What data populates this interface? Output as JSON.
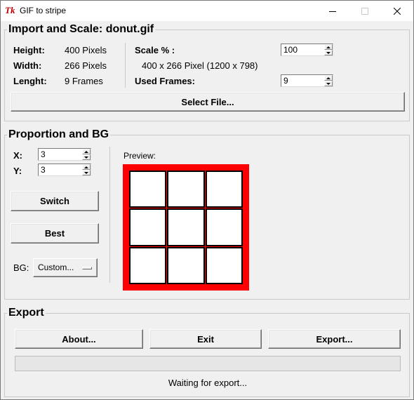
{
  "window": {
    "title": "GIF to stripe",
    "icon": "tk-feather-icon"
  },
  "import_group": {
    "title": "Import and Scale: donut.gif",
    "height_label": "Height:",
    "height_value": "400 Pixels",
    "width_label": "Width:",
    "width_value": "266 Pixels",
    "length_label": "Lenght:",
    "length_value": "9 Frames",
    "scale_label": "Scale % :",
    "scale_value": "100",
    "scaled_size": "400 x 266 Pixel (1200 x 798)",
    "used_frames_label": "Used Frames:",
    "used_frames_value": "9",
    "select_file_label": "Select File..."
  },
  "proportion_group": {
    "title": "Proportion and BG",
    "x_label": "X:",
    "x_value": "3",
    "y_label": "Y:",
    "y_value": "3",
    "switch_label": "Switch",
    "best_label": "Best",
    "bg_label": "BG:",
    "bg_value": "Custom...",
    "preview_label": "Preview:",
    "preview_bg_color": "#ff0000",
    "preview_cols": 3,
    "preview_rows": 3
  },
  "export_group": {
    "title": "Export",
    "about_label": "About...",
    "exit_label": "Exit",
    "export_label": "Export...",
    "progress": 0,
    "status_text": "Waiting for export..."
  }
}
